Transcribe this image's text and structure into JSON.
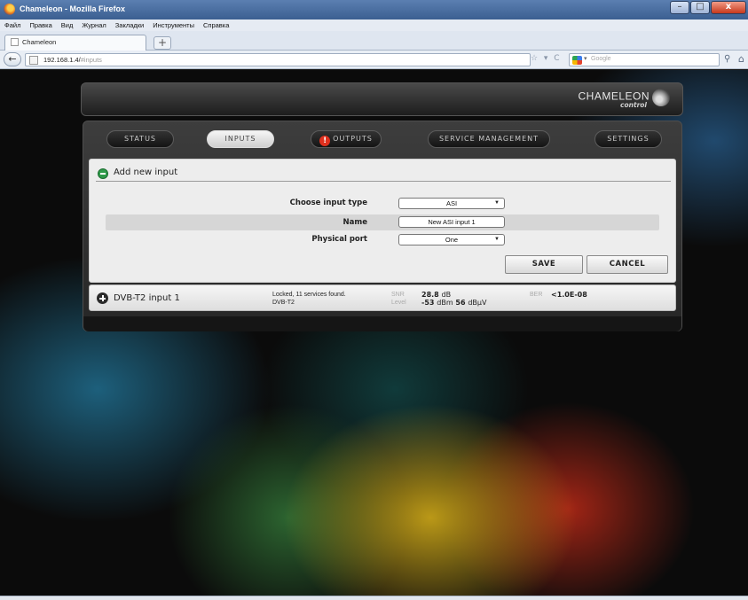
{
  "window": {
    "title": "Chameleon - Mozilla Firefox",
    "minimize": "–",
    "maximize": "□",
    "close": "x"
  },
  "menu": [
    "Файл",
    "Правка",
    "Вид",
    "Журнал",
    "Закладки",
    "Инструменты",
    "Справка"
  ],
  "tab": {
    "label": "Chameleon",
    "new_tab": "+"
  },
  "nav": {
    "back": "←",
    "url_host": "192.168.1.4/",
    "url_path": "#inputs",
    "url_tools": "☆ ▾ C",
    "search_placeholder": "Google",
    "search_caret": "▾",
    "search_go": "⚲",
    "home": "⌂"
  },
  "app": {
    "logo_name": "CHAMELEON",
    "logo_sub": "control",
    "tabs": [
      {
        "label": "STATUS"
      },
      {
        "label": "INPUTS"
      },
      {
        "label": "OUTPUTS",
        "alert": "!"
      },
      {
        "label": "SERVICE MANAGEMENT"
      },
      {
        "label": "SETTINGS"
      }
    ],
    "form": {
      "title": "Add new input",
      "input_type_label": "Choose input type",
      "input_type_value": "ASI",
      "name_label": "Name",
      "name_value": "New ASI input 1",
      "port_label": "Physical port",
      "port_value": "One",
      "save": "SAVE",
      "cancel": "CANCEL"
    },
    "input_row": {
      "name": "DVB-T2 input 1",
      "status_line1": "Locked, 11 services found.",
      "status_line2": "DVB-T2",
      "snr_label": "SNR",
      "snr_value": "28.8",
      "snr_unit": "dB",
      "level_label": "Level",
      "level_dbm": "-53",
      "level_dbm_unit": "dBm",
      "level_dbuv": "56",
      "level_dbuv_unit": "dBµV",
      "ber_label": "BER",
      "ber_value": "<1.0E-08"
    }
  }
}
